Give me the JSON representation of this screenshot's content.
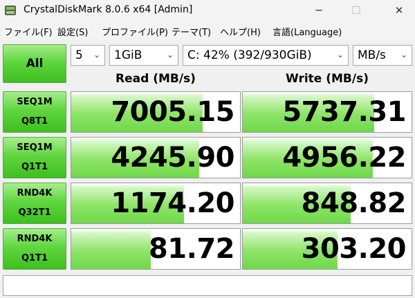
{
  "window": {
    "title": "CrystalDiskMark 8.0.6 x64 [Admin]",
    "minimize_glyph": "─",
    "maximize_glyph": "☐",
    "close_glyph": "✕"
  },
  "menu": [
    {
      "label": "ファイル(F)"
    },
    {
      "label": "設定(S)"
    },
    {
      "label": "プロファイル(P)"
    },
    {
      "label": "テーマ(T)"
    },
    {
      "label": "ヘルプ(H)"
    },
    {
      "label": "言語(Language)"
    }
  ],
  "controls": {
    "all_label": "All",
    "count": "5",
    "size": "1GiB",
    "drive": "C: 42% (392/930GiB)",
    "unit": "MB/s"
  },
  "headers": {
    "read": "Read (MB/s)",
    "write": "Write (MB/s)"
  },
  "tests": [
    {
      "line1": "SEQ1M",
      "line2": "Q8T1",
      "read": "7005.15",
      "write": "5737.31",
      "read_fill": 0.78,
      "write_fill": 0.78
    },
    {
      "line1": "SEQ1M",
      "line2": "Q1T1",
      "read": "4245.90",
      "write": "4956.22",
      "read_fill": 0.76,
      "write_fill": 0.77
    },
    {
      "line1": "RND4K",
      "line2": "Q32T1",
      "read": "1174.20",
      "write": "848.82",
      "read_fill": 0.67,
      "write_fill": 0.64
    },
    {
      "line1": "RND4K",
      "line2": "Q1T1",
      "read": "81.72",
      "write": "303.20",
      "read_fill": 0.47,
      "write_fill": 0.56
    }
  ],
  "colors": {
    "button_green": "#4fcc2d",
    "bar_green": "#7ddc55"
  },
  "icons": {
    "app": "crystaldiskmark-icon",
    "dropdown": "chevron-down-icon"
  }
}
